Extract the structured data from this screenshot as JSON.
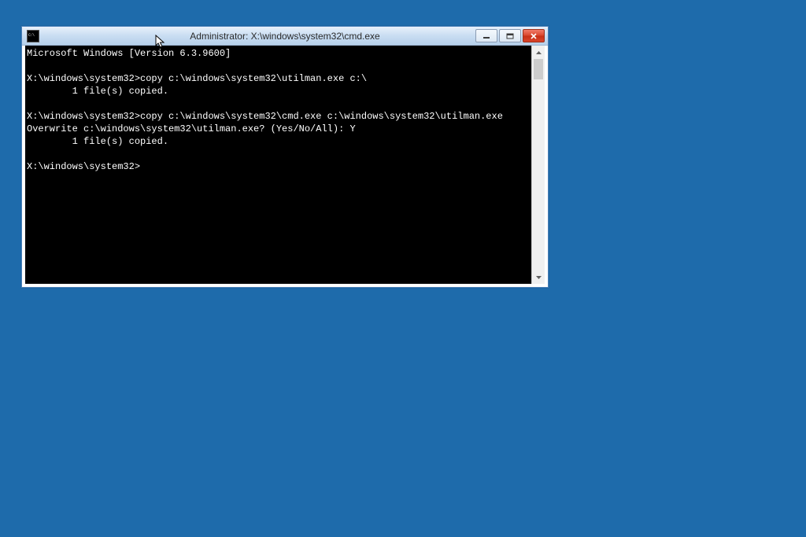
{
  "window": {
    "title": "Administrator: X:\\windows\\system32\\cmd.exe"
  },
  "terminal": {
    "lines": [
      "Microsoft Windows [Version 6.3.9600]",
      "",
      "X:\\windows\\system32>copy c:\\windows\\system32\\utilman.exe c:\\",
      "        1 file(s) copied.",
      "",
      "X:\\windows\\system32>copy c:\\windows\\system32\\cmd.exe c:\\windows\\system32\\utilman.exe",
      "Overwrite c:\\windows\\system32\\utilman.exe? (Yes/No/All): Y",
      "        1 file(s) copied.",
      "",
      "X:\\windows\\system32>"
    ]
  }
}
